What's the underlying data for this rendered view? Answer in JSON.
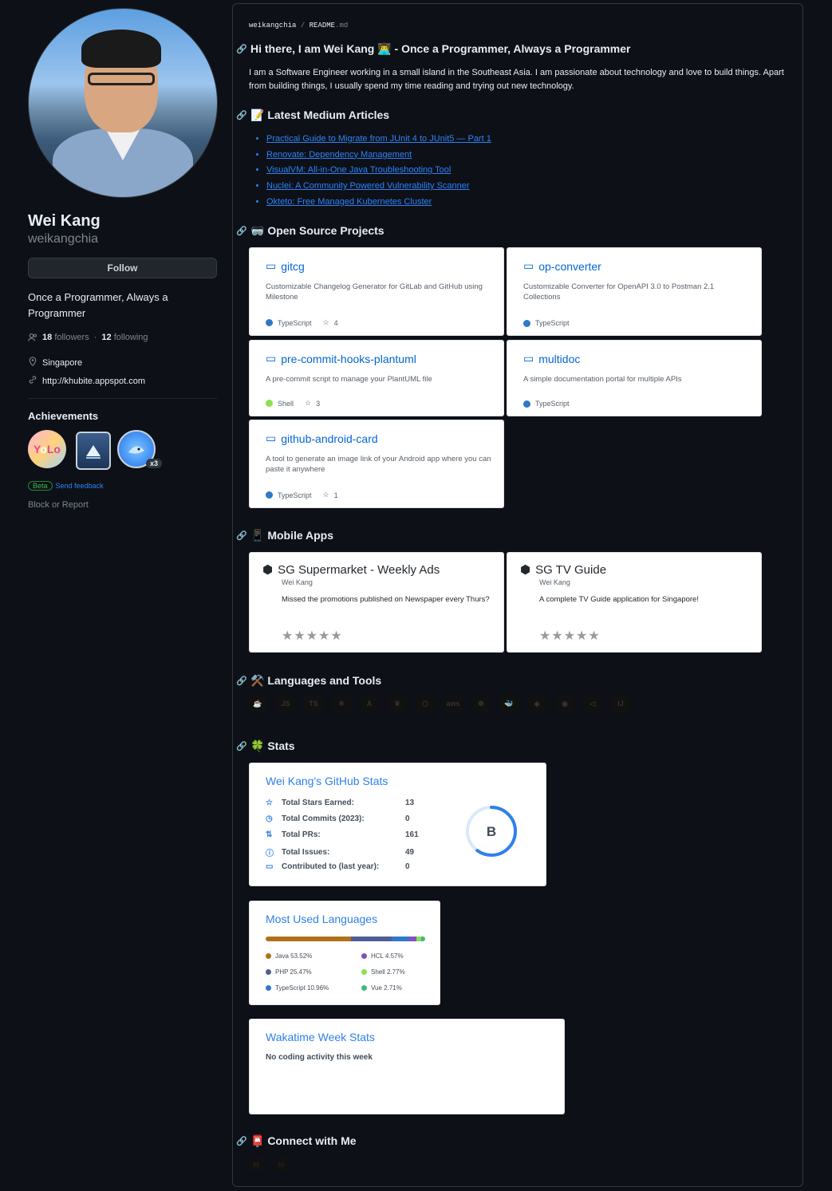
{
  "sidebar": {
    "name": "Wei Kang",
    "login": "weikangchia",
    "follow_label": "Follow",
    "bio": "Once a Programmer, Always a Programmer",
    "followers_count": "18",
    "followers_label": "followers",
    "following_count": "12",
    "following_label": "following",
    "location": "Singapore",
    "website": "http://khubite.appspot.com",
    "achievements_title": "Achievements",
    "achievement_badges": [
      "YOLO",
      "Arctic Code Vault",
      "Pull Shark"
    ],
    "pull_shark_count": "x3",
    "beta_label": "Beta",
    "feedback_label": "Send feedback",
    "block_label": "Block or Report"
  },
  "readme": {
    "breadcrumb_user": "weikangchia",
    "breadcrumb_sep": "/",
    "breadcrumb_file": "README",
    "breadcrumb_ext": ".md",
    "greeting": "Hi there, I am Wei Kang 👨‍💻 - Once a Programmer, Always a Programmer",
    "intro": "I am a Software Engineer working in a small island in the Southeast Asia. I am passionate about technology and love to build things. Apart from building things, I usually spend my time reading and trying out new technology.",
    "sections": {
      "articles": "📝 Latest Medium Articles",
      "projects": "🥽 Open Source Projects",
      "mobile": "📱 Mobile Apps",
      "tools": "⚒️ Languages and Tools",
      "stats": "🍀 Stats",
      "connect": "📮 Connect with Me"
    },
    "articles": [
      "Practical Guide to Migrate from JUnit 4 to JUnit5 — Part 1",
      "Renovate: Dependency Management",
      "VisualVM: All-in-One Java Troubleshooting Tool",
      "Nuclei: A Community Powered Vulnerability Scanner",
      "Okteto: Free Managed Kubernetes Cluster"
    ],
    "repos": [
      {
        "name": "gitcg",
        "desc": "Customizable Changelog Generator for GitLab and GitHub using Milestone",
        "lang": "TypeScript",
        "color": "#3178c6",
        "stars": "4"
      },
      {
        "name": "op-converter",
        "desc": "Customizable Converter for OpenAPI 3.0 to Postman 2.1 Collections",
        "lang": "TypeScript",
        "color": "#3178c6",
        "stars": ""
      },
      {
        "name": "pre-commit-hooks-plantuml",
        "desc": "A pre-commit script to manage your PlantUML file",
        "lang": "Shell",
        "color": "#89e051",
        "stars": "3"
      },
      {
        "name": "multidoc",
        "desc": "A simple documentation portal for multiple APIs",
        "lang": "TypeScript",
        "color": "#3178c6",
        "stars": ""
      },
      {
        "name": "github-android-card",
        "desc": "A tool to generate an image link of your Android app where you can paste it anywhere",
        "lang": "TypeScript",
        "color": "#3178c6",
        "stars": "1"
      }
    ],
    "apps": [
      {
        "name": "SG Supermarket - Weekly Ads",
        "dev": "Wei Kang",
        "desc": "Missed the promotions published on Newspaper every Thurs?",
        "rating": "★★★★★"
      },
      {
        "name": "SG TV Guide",
        "dev": "Wei Kang",
        "desc": "A complete TV Guide application for Singapore!",
        "rating": "★★★★★"
      }
    ],
    "tools": [
      "java-icon",
      "javascript-icon",
      "typescript-icon",
      "react-icon",
      "angular-icon",
      "spring-icon",
      "nodejs-icon",
      "aws-icon",
      "kubernetes-icon",
      "docker-icon",
      "git-icon",
      "sonar-icon",
      "vscode-icon",
      "intellij-icon"
    ],
    "github_stats": {
      "title": "Wei Kang's GitHub Stats",
      "rows": [
        {
          "icon": "star-icon",
          "label": "Total Stars Earned:",
          "value": "13"
        },
        {
          "icon": "history-icon",
          "label": "Total Commits (2023):",
          "value": "0"
        },
        {
          "icon": "pr-icon",
          "label": "Total PRs:",
          "value": "161"
        },
        {
          "icon": "issue-icon",
          "label": "Total Issues:",
          "value": "49"
        },
        {
          "icon": "repo-icon",
          "label": "Contributed to (last year):",
          "value": "0"
        }
      ],
      "rank": "B",
      "rank_progress": 0.6
    },
    "languages": {
      "title": "Most Used Languages",
      "items": [
        {
          "name": "Java 53.52%",
          "pct": 53.52,
          "color": "#b07219"
        },
        {
          "name": "HCL 4.57%",
          "pct": 4.57,
          "color": "#844fba"
        },
        {
          "name": "PHP 25.47%",
          "pct": 25.47,
          "color": "#4f5d95"
        },
        {
          "name": "Shell 2.77%",
          "pct": 2.77,
          "color": "#89e051"
        },
        {
          "name": "TypeScript 10.96%",
          "pct": 10.96,
          "color": "#3178c6"
        },
        {
          "name": "Vue 2.71%",
          "pct": 2.71,
          "color": "#41b883"
        }
      ]
    },
    "wakatime": {
      "title": "Wakatime Week Stats",
      "message": "No coding activity this week"
    },
    "connect": [
      "medium-icon",
      "linkedin-icon"
    ]
  }
}
